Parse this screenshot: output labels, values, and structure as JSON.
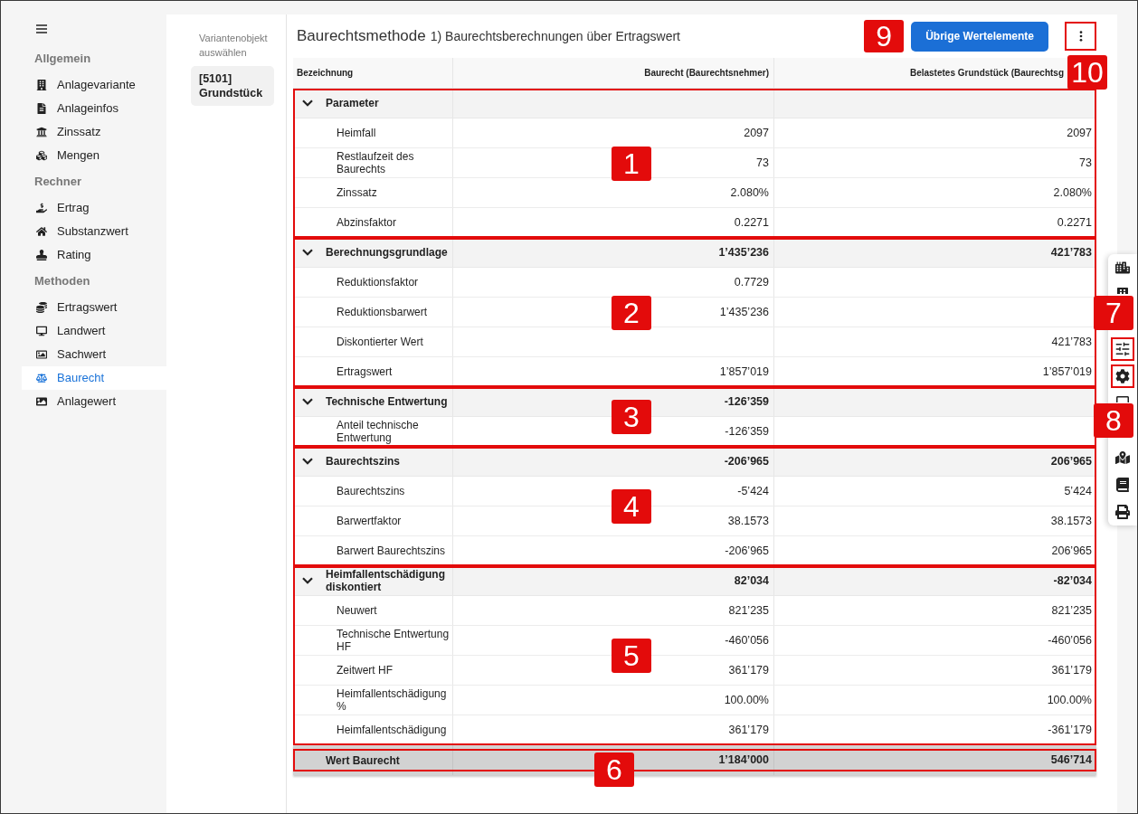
{
  "sidebar": {
    "groups": [
      {
        "title": "Allgemein",
        "items": [
          {
            "label": "Anlagevariante",
            "selected": false
          },
          {
            "label": "Anlageinfos",
            "selected": false
          },
          {
            "label": "Zinssatz",
            "selected": false
          },
          {
            "label": "Mengen",
            "selected": false
          }
        ]
      },
      {
        "title": "Rechner",
        "items": [
          {
            "label": "Ertrag",
            "selected": false
          },
          {
            "label": "Substanzwert",
            "selected": false
          },
          {
            "label": "Rating",
            "selected": false
          }
        ]
      },
      {
        "title": "Methoden",
        "items": [
          {
            "label": "Ertragswert",
            "selected": false
          },
          {
            "label": "Landwert",
            "selected": false
          },
          {
            "label": "Sachwert",
            "selected": false
          },
          {
            "label": "Baurecht",
            "selected": true
          },
          {
            "label": "Anlagewert",
            "selected": false
          }
        ]
      }
    ]
  },
  "variant_picker": {
    "label": "Variantenobjekt auswählen",
    "items": [
      {
        "label": "[5101] Grundstück",
        "selected": true
      }
    ]
  },
  "header": {
    "title": "Baurechtsmethode",
    "subtitle": "1) Baurechtsberechnungen über Ertragswert",
    "action_button": {
      "label": "Übrige Wertelemente",
      "callout": "9"
    },
    "more_button": {
      "callout": "10"
    }
  },
  "table": {
    "columns": [
      "Bezeichnung",
      "Baurecht (Baurechtsnehmer)",
      "Belastetes Grundstück (Baurechtsg"
    ],
    "sections": [
      {
        "label": "Parameter",
        "expanded": true,
        "callout": "1",
        "rows": [
          {
            "label": "Heimfall",
            "baurecht": "2097",
            "belastetes_grundstueck": "2097"
          },
          {
            "label": "Restlaufzeit des Baurechts",
            "baurecht": "73",
            "belastetes_grundstueck": "73"
          },
          {
            "label": "Zinssatz",
            "baurecht": "2.080%",
            "belastetes_grundstueck": "2.080%"
          },
          {
            "label": "Abzinsfaktor",
            "baurecht": "0.2271",
            "belastetes_grundstueck": "0.2271"
          }
        ]
      },
      {
        "label": "Berechnungsgrundlage",
        "baurecht": "1’435’236",
        "belastetes_grundstueck": "421’783",
        "expanded": true,
        "callout": "2",
        "rows": [
          {
            "label": "Reduktionsfaktor",
            "baurecht": "0.7729"
          },
          {
            "label": "Reduktionsbarwert",
            "baurecht": "1’435’236"
          },
          {
            "label": "Diskontierter Wert",
            "belastetes_grundstueck": "421’783"
          },
          {
            "label": "Ertragswert",
            "baurecht": "1’857’019",
            "belastetes_grundstueck": "1’857’019"
          }
        ]
      },
      {
        "label": "Technische Entwertung",
        "baurecht": "-126’359",
        "expanded": true,
        "callout": "3",
        "rows": [
          {
            "label": "Anteil technische Entwertung",
            "baurecht": "-126’359"
          }
        ]
      },
      {
        "label": "Baurechtszins",
        "baurecht": "-206’965",
        "belastetes_grundstueck": "206’965",
        "expanded": true,
        "callout": "4",
        "rows": [
          {
            "label": "Baurechtszins",
            "baurecht": "-5’424",
            "belastetes_grundstueck": "5’424"
          },
          {
            "label": "Barwertfaktor",
            "baurecht": "38.1573",
            "belastetes_grundstueck": "38.1573"
          },
          {
            "label": "Barwert Baurechtszins",
            "baurecht": "-206’965",
            "belastetes_grundstueck": "206’965"
          }
        ]
      },
      {
        "label": "Heimfallentschädigung diskontiert",
        "baurecht": "82’034",
        "belastetes_grundstueck": "-82’034",
        "expanded": true,
        "callout": "5",
        "rows": [
          {
            "label": "Neuwert",
            "baurecht": "821’235",
            "belastetes_grundstueck": "821’235"
          },
          {
            "label": "Technische Entwertung HF",
            "baurecht": "-460’056",
            "belastetes_grundstueck": "-460’056"
          },
          {
            "label": "Zeitwert HF",
            "baurecht": "361’179",
            "belastetes_grundstueck": "361’179"
          },
          {
            "label": "Heimfallentschädigung %",
            "baurecht": "100.00%",
            "belastetes_grundstueck": "100.00%"
          },
          {
            "label": "Heimfallentschädigung",
            "baurecht": "361’179",
            "belastetes_grundstueck": "-361’179"
          }
        ]
      }
    ],
    "total": {
      "label": "Wert Baurecht",
      "baurecht": "1’184’000",
      "belastetes_grundstueck": "546’714",
      "callout": "6"
    }
  },
  "toolbar": {
    "callouts": [
      "7",
      "8"
    ]
  }
}
